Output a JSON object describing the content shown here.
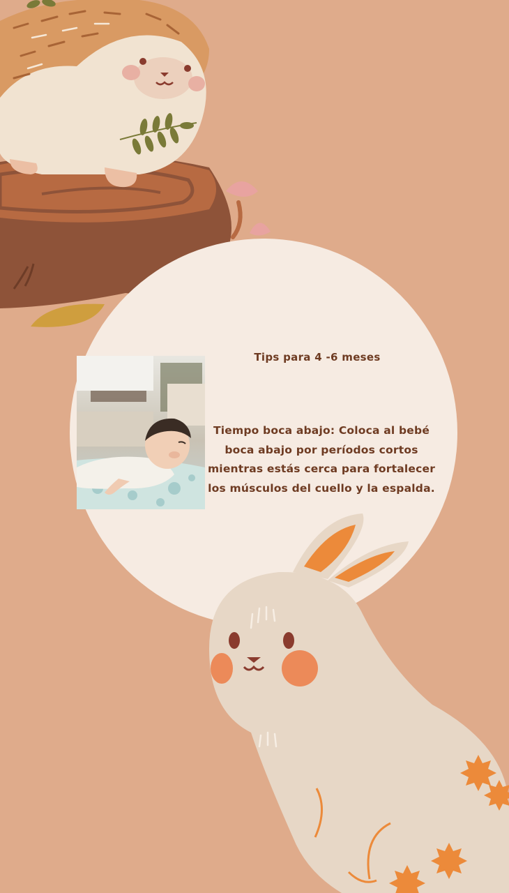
{
  "tip": {
    "title": "Tips para 4 -6 meses",
    "body": "Tiempo boca abajo: Coloca al bebé boca abajo por períodos cortos mientras estás cerca para fortalecer los músculos del cuello y la espalda."
  },
  "colors": {
    "background": "#dfab8b",
    "circle": "#f6ebe2",
    "text": "#6e3b22",
    "stump": "#8e5339",
    "hedgehog_fur": "#d99a63",
    "bunny": "#e7d7c6",
    "accent_orange": "#ec8a3a"
  },
  "illustrations": [
    "hedgehog-illustration",
    "tree-stump-illustration",
    "mushroom-illustration",
    "bunny-illustration",
    "maple-leaf-icon",
    "baby-photo"
  ]
}
